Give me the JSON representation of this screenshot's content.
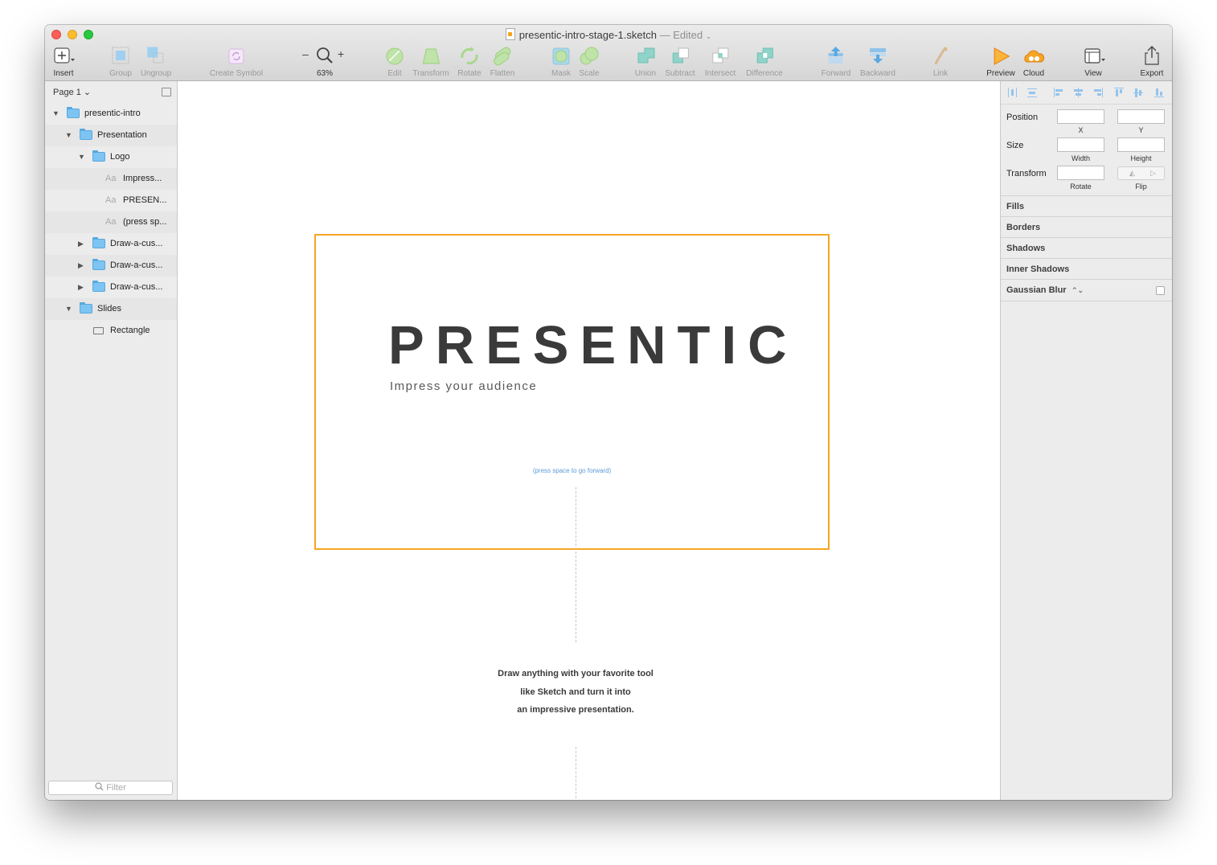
{
  "window": {
    "doc_name": "presentic-intro-stage-1.sketch",
    "doc_status": "— Edited",
    "status_caret": "⌄"
  },
  "toolbar": {
    "insert": "Insert",
    "group": "Group",
    "ungroup": "Ungroup",
    "create_symbol": "Create Symbol",
    "zoom_minus": "–",
    "zoom_plus": "+",
    "zoom_level": "63%",
    "edit": "Edit",
    "transform": "Transform",
    "rotate": "Rotate",
    "flatten": "Flatten",
    "mask": "Mask",
    "scale": "Scale",
    "union": "Union",
    "subtract": "Subtract",
    "intersect": "Intersect",
    "difference": "Difference",
    "forward": "Forward",
    "backward": "Backward",
    "link": "Link",
    "preview": "Preview",
    "cloud": "Cloud",
    "view": "View",
    "export": "Export"
  },
  "sidebar": {
    "page": "Page 1 ⌄",
    "filter_placeholder": "Filter",
    "layers": [
      {
        "name": "presentic-intro"
      },
      {
        "name": "Presentation"
      },
      {
        "name": "Logo"
      },
      {
        "name": "Impress..."
      },
      {
        "name": "PRESEN..."
      },
      {
        "name": "(press sp..."
      },
      {
        "name": "Draw-a-cus..."
      },
      {
        "name": "Draw-a-cus..."
      },
      {
        "name": "Draw-a-cus..."
      },
      {
        "name": "Slides"
      },
      {
        "name": "Rectangle"
      }
    ],
    "text_layer_glyph": "Aa"
  },
  "canvas": {
    "logo_title": "PRESENTIC",
    "logo_subtitle": "Impress your audience",
    "press_hint": "(press space to go forward)",
    "intro_lines": [
      "Draw anything with your favorite tool",
      "like Sketch and turn it into",
      "an impressive presentation."
    ]
  },
  "inspector": {
    "position": "Position",
    "x": "X",
    "y": "Y",
    "size": "Size",
    "width": "Width",
    "height": "Height",
    "transform": "Transform",
    "rotate": "Rotate",
    "flip": "Flip",
    "fills": "Fills",
    "borders": "Borders",
    "shadows": "Shadows",
    "inner_shadows": "Inner Shadows",
    "gaussian_blur": "Gaussian Blur",
    "gaussian_caret": "⌃⌄"
  },
  "colors": {
    "accent": "#f5a623",
    "folder": "#7dc4f3",
    "hint": "#5a9ad8"
  }
}
